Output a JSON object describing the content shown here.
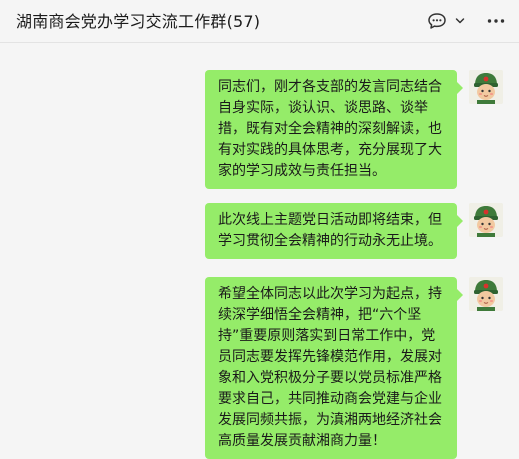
{
  "header": {
    "title": "湖南商会党办学习交流工作群(57)",
    "chat_icon": "chat-bubble-icon",
    "dropdown_icon": "chevron-down-icon",
    "more_icon": "more-dots-icon"
  },
  "messages": [
    {
      "text": "同志们，刚才各支部的发言同志结合自身实际，谈认识、谈思路、谈举措，既有对全会精神的深刻解读，也有对实践的具体思考，充分展现了大家的学习成效与责任担当。",
      "avatar_icon": "soldier-avatar-icon"
    },
    {
      "text": "此次线上主题党日活动即将结束，但学习贯彻全会精神的行动永无止境。",
      "avatar_icon": "soldier-avatar-icon"
    },
    {
      "text": "希望全体同志以此次学习为起点，持续深学细悟全会精神，把“六个坚持”重要原则落实到日常工作中，党员同志要发挥先锋模范作用，发展对象和入党积极分子要以党员标准严格要求自己，共同推动商会党建与企业发展同频共振，为滇湘两地经济社会高质量发展贡献湘商力量！",
      "avatar_icon": "soldier-avatar-icon"
    }
  ],
  "colors": {
    "bubble": "#95ec69",
    "background": "#f5f5f5"
  }
}
